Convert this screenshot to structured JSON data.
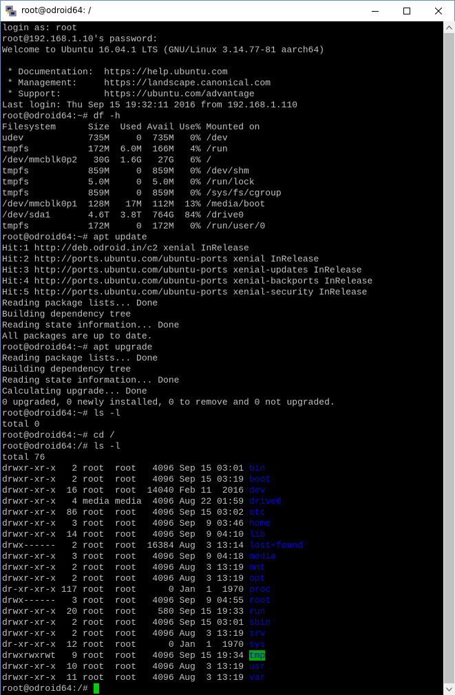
{
  "window": {
    "title": "root@odroid64: /",
    "icon": "putty-icon",
    "controls": [
      "minimize-icon",
      "maximize-icon",
      "close-icon"
    ]
  },
  "terminal": {
    "lines": [
      [
        {
          "t": "login as: root"
        }
      ],
      [
        {
          "t": "root@192.168.1.10's password:"
        }
      ],
      [
        {
          "t": "Welcome to Ubuntu 16.04.1 LTS (GNU/Linux 3.14.77-81 aarch64)"
        }
      ],
      [
        {
          "t": ""
        }
      ],
      [
        {
          "t": " * Documentation:  https://help.ubuntu.com"
        }
      ],
      [
        {
          "t": " * Management:     https://landscape.canonical.com"
        }
      ],
      [
        {
          "t": " * Support:        https://ubuntu.com/advantage"
        }
      ],
      [
        {
          "t": "Last login: Thu Sep 15 19:32:11 2016 from 192.168.1.110"
        }
      ],
      [
        {
          "t": "root@odroid64:~# df -h"
        }
      ],
      [
        {
          "t": "Filesystem      Size  Used Avail Use% Mounted on"
        }
      ],
      [
        {
          "t": "udev            735M     0  735M   0% /dev"
        }
      ],
      [
        {
          "t": "tmpfs           172M  6.0M  166M   4% /run"
        }
      ],
      [
        {
          "t": "/dev/mmcblk0p2   30G  1.6G   27G   6% /"
        }
      ],
      [
        {
          "t": "tmpfs           859M     0  859M   0% /dev/shm"
        }
      ],
      [
        {
          "t": "tmpfs           5.0M     0  5.0M   0% /run/lock"
        }
      ],
      [
        {
          "t": "tmpfs           859M     0  859M   0% /sys/fs/cgroup"
        }
      ],
      [
        {
          "t": "/dev/mmcblk0p1  128M   17M  112M  13% /media/boot"
        }
      ],
      [
        {
          "t": "/dev/sda1       4.6T  3.8T  764G  84% /drive0"
        }
      ],
      [
        {
          "t": "tmpfs           172M     0  172M   0% /run/user/0"
        }
      ],
      [
        {
          "t": "root@odroid64:~# apt update"
        }
      ],
      [
        {
          "t": "Hit:1 http://deb.odroid.in/c2 xenial InRelease"
        }
      ],
      [
        {
          "t": "Hit:2 http://ports.ubuntu.com/ubuntu-ports xenial InRelease"
        }
      ],
      [
        {
          "t": "Hit:3 http://ports.ubuntu.com/ubuntu-ports xenial-updates InRelease"
        }
      ],
      [
        {
          "t": "Hit:4 http://ports.ubuntu.com/ubuntu-ports xenial-backports InRelease"
        }
      ],
      [
        {
          "t": "Hit:5 http://ports.ubuntu.com/ubuntu-ports xenial-security InRelease"
        }
      ],
      [
        {
          "t": "Reading package lists... Done"
        }
      ],
      [
        {
          "t": "Building dependency tree"
        }
      ],
      [
        {
          "t": "Reading state information... Done"
        }
      ],
      [
        {
          "t": "All packages are up to date."
        }
      ],
      [
        {
          "t": "root@odroid64:~# apt upgrade"
        }
      ],
      [
        {
          "t": "Reading package lists... Done"
        }
      ],
      [
        {
          "t": "Building dependency tree"
        }
      ],
      [
        {
          "t": "Reading state information... Done"
        }
      ],
      [
        {
          "t": "Calculating upgrade... Done"
        }
      ],
      [
        {
          "t": "0 upgraded, 0 newly installed, 0 to remove and 0 not upgraded."
        }
      ],
      [
        {
          "t": "root@odroid64:~# ls -l"
        }
      ],
      [
        {
          "t": "total 0"
        }
      ],
      [
        {
          "t": "root@odroid64:~# cd /"
        }
      ],
      [
        {
          "t": "root@odroid64:/# ls -l"
        }
      ],
      [
        {
          "t": "total 76"
        }
      ],
      [
        {
          "t": "drwxr-xr-x   2 root  root   4096 Sep 15 03:01 "
        },
        {
          "t": "bin",
          "c": "blue"
        }
      ],
      [
        {
          "t": "drwxr-xr-x   2 root  root   4096 Sep 15 03:19 "
        },
        {
          "t": "boot",
          "c": "blue"
        }
      ],
      [
        {
          "t": "drwxr-xr-x  16 root  root  14040 Feb 11  2016 "
        },
        {
          "t": "dev",
          "c": "blue"
        }
      ],
      [
        {
          "t": "drwxr-xr-x   4 media media  4096 Aug 22 01:59 "
        },
        {
          "t": "drive0",
          "c": "blue"
        }
      ],
      [
        {
          "t": "drwxr-xr-x  86 root  root   4096 Sep 15 03:02 "
        },
        {
          "t": "etc",
          "c": "blue"
        }
      ],
      [
        {
          "t": "drwxr-xr-x   3 root  root   4096 Sep  9 03:46 "
        },
        {
          "t": "home",
          "c": "blue"
        }
      ],
      [
        {
          "t": "drwxr-xr-x  14 root  root   4096 Sep  9 04:10 "
        },
        {
          "t": "lib",
          "c": "blue"
        }
      ],
      [
        {
          "t": "drwx------   2 root  root  16384 Aug  3 13:14 "
        },
        {
          "t": "lost+found",
          "c": "blue"
        }
      ],
      [
        {
          "t": "drwxr-xr-x   3 root  root   4096 Sep  9 04:18 "
        },
        {
          "t": "media",
          "c": "blue"
        }
      ],
      [
        {
          "t": "drwxr-xr-x   2 root  root   4096 Aug  3 13:19 "
        },
        {
          "t": "mnt",
          "c": "blue"
        }
      ],
      [
        {
          "t": "drwxr-xr-x   2 root  root   4096 Aug  3 13:19 "
        },
        {
          "t": "opt",
          "c": "blue"
        }
      ],
      [
        {
          "t": "dr-xr-xr-x 117 root  root      0 Jan  1  1970 "
        },
        {
          "t": "proc",
          "c": "blue"
        }
      ],
      [
        {
          "t": "drwx------   3 root  root   4096 Sep  9 04:55 "
        },
        {
          "t": "root",
          "c": "blue"
        }
      ],
      [
        {
          "t": "drwxr-xr-x  20 root  root    580 Sep 15 19:33 "
        },
        {
          "t": "run",
          "c": "blue"
        }
      ],
      [
        {
          "t": "drwxr-xr-x   2 root  root   4096 Sep 15 03:01 "
        },
        {
          "t": "sbin",
          "c": "blue"
        }
      ],
      [
        {
          "t": "drwxr-xr-x   2 root  root   4096 Aug  3 13:19 "
        },
        {
          "t": "srv",
          "c": "blue"
        }
      ],
      [
        {
          "t": "dr-xr-xr-x  12 root  root      0 Jan  1  1970 "
        },
        {
          "t": "sys",
          "c": "blue"
        }
      ],
      [
        {
          "t": "drwxrwxrwt   9 root  root   4096 Sep 15 19:34 "
        },
        {
          "t": "tmp",
          "c": "green-bg"
        }
      ],
      [
        {
          "t": "drwxr-xr-x  10 root  root   4096 Aug  3 13:19 "
        },
        {
          "t": "usr",
          "c": "blue"
        }
      ],
      [
        {
          "t": "drwxr-xr-x  11 root  root   4096 Aug  3 13:19 "
        },
        {
          "t": "var",
          "c": "blue"
        }
      ],
      [
        {
          "t": "root@odroid64:/# "
        },
        {
          "cursor": true
        }
      ]
    ]
  },
  "colors": {
    "terminal_bg": "#000000",
    "terminal_fg": "#c0c0c0",
    "dir_blue": "#0000ee",
    "sticky_bg": "#00a800",
    "cursor": "#00d000"
  }
}
